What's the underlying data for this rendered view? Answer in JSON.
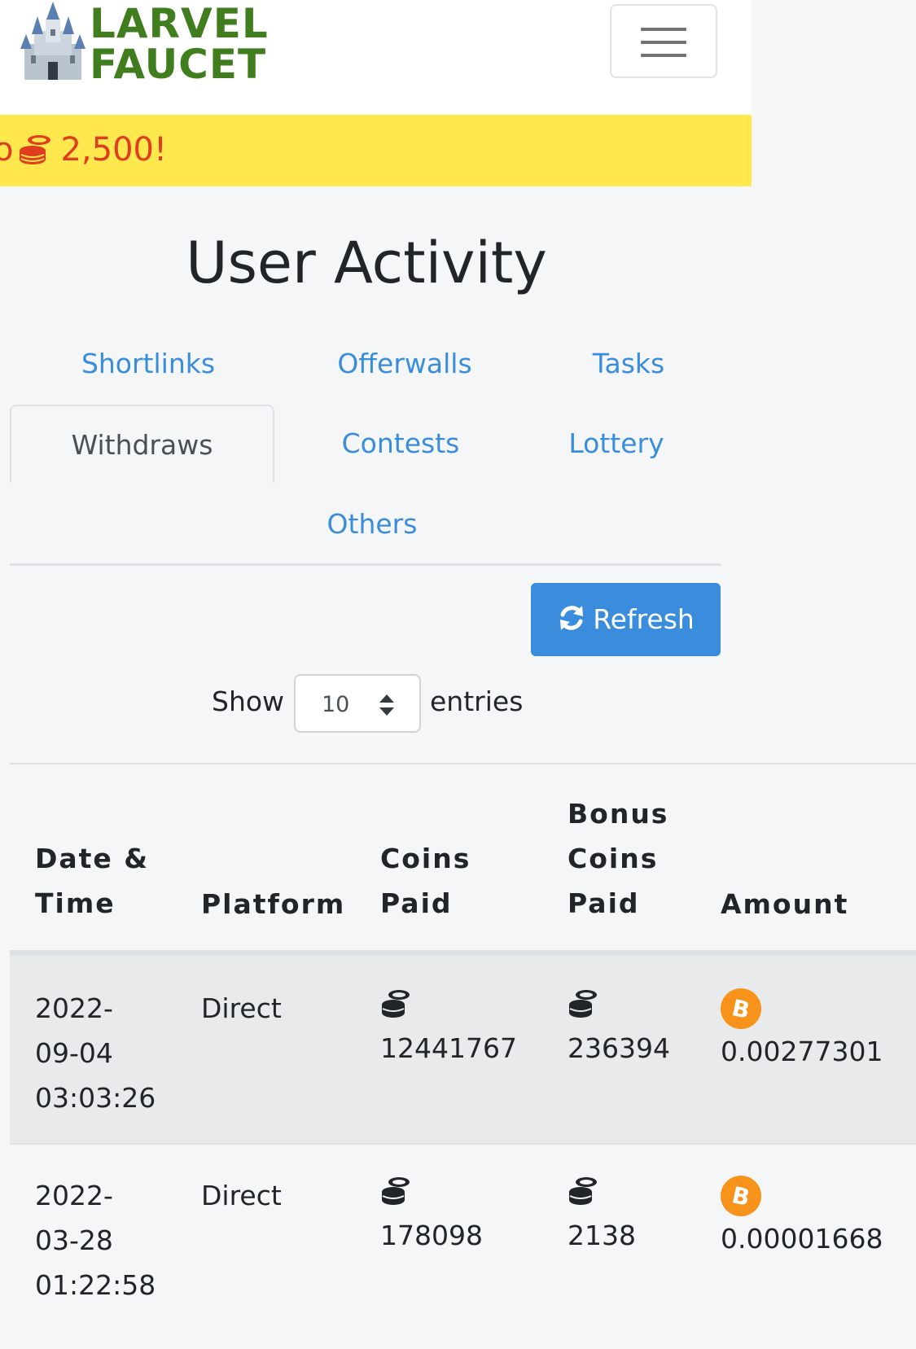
{
  "header": {
    "logo_line1": "LARVEL",
    "logo_line2": "FAUCET",
    "logo_color": "#3f7d1e"
  },
  "promo": {
    "partial_text": "o",
    "amount_text": "2,500!",
    "background": "#ffe84d",
    "text_color": "#e03c1f"
  },
  "page": {
    "title": "User Activity"
  },
  "tabs": [
    {
      "label": "Shortlinks",
      "active": false
    },
    {
      "label": "Offerwalls",
      "active": false
    },
    {
      "label": "Tasks",
      "active": false
    },
    {
      "label": "Withdraws",
      "active": true
    },
    {
      "label": "Contests",
      "active": false
    },
    {
      "label": "Lottery",
      "active": false
    },
    {
      "label": "Others",
      "active": false
    }
  ],
  "toolbar": {
    "refresh_label": "Refresh",
    "accent": "#3a8ddc"
  },
  "length_menu": {
    "show_label": "Show",
    "value": "10",
    "entries_label": "entries"
  },
  "table": {
    "headers": {
      "date_line1": "Date &",
      "date_line2": "Time",
      "platform": "Platform",
      "coins_line1": "Coins",
      "coins_line2": "Paid",
      "bonus_line1": "Bonus",
      "bonus_line2": "Coins",
      "bonus_line3": "Paid",
      "amount": "Amount"
    },
    "rows": [
      {
        "date_line1": "2022-",
        "date_line2": "09-04",
        "date_line3": "03:03:26",
        "platform": "Direct",
        "coins_paid": "12441767",
        "bonus_coins_paid": "236394",
        "amount": "0.00277301"
      },
      {
        "date_line1": "2022-",
        "date_line2": "03-28",
        "date_line3": "01:22:58",
        "platform": "Direct",
        "coins_paid": "178098",
        "bonus_coins_paid": "2138",
        "amount": "0.00001668"
      }
    ]
  },
  "icons": {
    "coins": "coins-stack-icon",
    "bitcoin": "bitcoin-icon",
    "refresh": "refresh-icon",
    "menu": "hamburger-icon"
  }
}
